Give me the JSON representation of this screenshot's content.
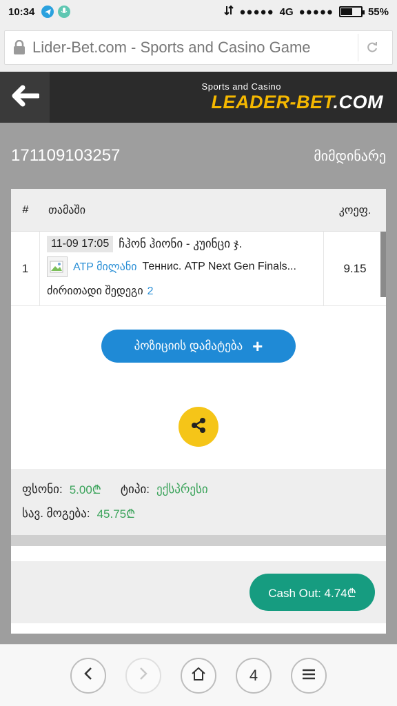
{
  "status_bar": {
    "time": "10:34",
    "network": "4G",
    "battery": "55%",
    "battery_level": 0.55,
    "icons": [
      "telegram-icon",
      "microphone-icon",
      "data-transfer-icon",
      "signal-icon",
      "battery-icon"
    ]
  },
  "browser": {
    "url": "Lider-Bet.com - Sports and Casino Game"
  },
  "site": {
    "logo_sub": "Sports and Casino",
    "logo_main": "LEADER-BET",
    "logo_suffix": ".COM"
  },
  "bet": {
    "id": "171109103257",
    "status": "მიმდინარე"
  },
  "table": {
    "headers": {
      "num": "#",
      "game": "თამაში",
      "odds": "კოეფ."
    },
    "rows": [
      {
        "num": "1",
        "date": "11-09 17:05",
        "match": "ჩჰონ ჰიონი - კუინცი ჯ.",
        "league": "ATP მილანი",
        "tournament": "Теннис. ATP Next Gen Finals...",
        "market": "ძირითადი შედეგი",
        "market_value": "2",
        "odds": "9.15"
      }
    ]
  },
  "actions": {
    "add_position": "პოზიციის დამატება",
    "cash_out": "Cash Out: 4.74₾"
  },
  "summary": {
    "stake_label": "ფსონი:",
    "stake_value": "5.00₾",
    "type_label": "ტიპი:",
    "type_value": "ექსპრესი",
    "win_label": "სავ. მოგება:",
    "win_value": "45.75₾"
  },
  "bottom_nav": {
    "tabs_count": "4"
  },
  "colors": {
    "accent_yellow": "#f5b800",
    "accent_blue": "#1f8ad6",
    "accent_green": "#169c80",
    "value_green": "#3aa35a"
  }
}
